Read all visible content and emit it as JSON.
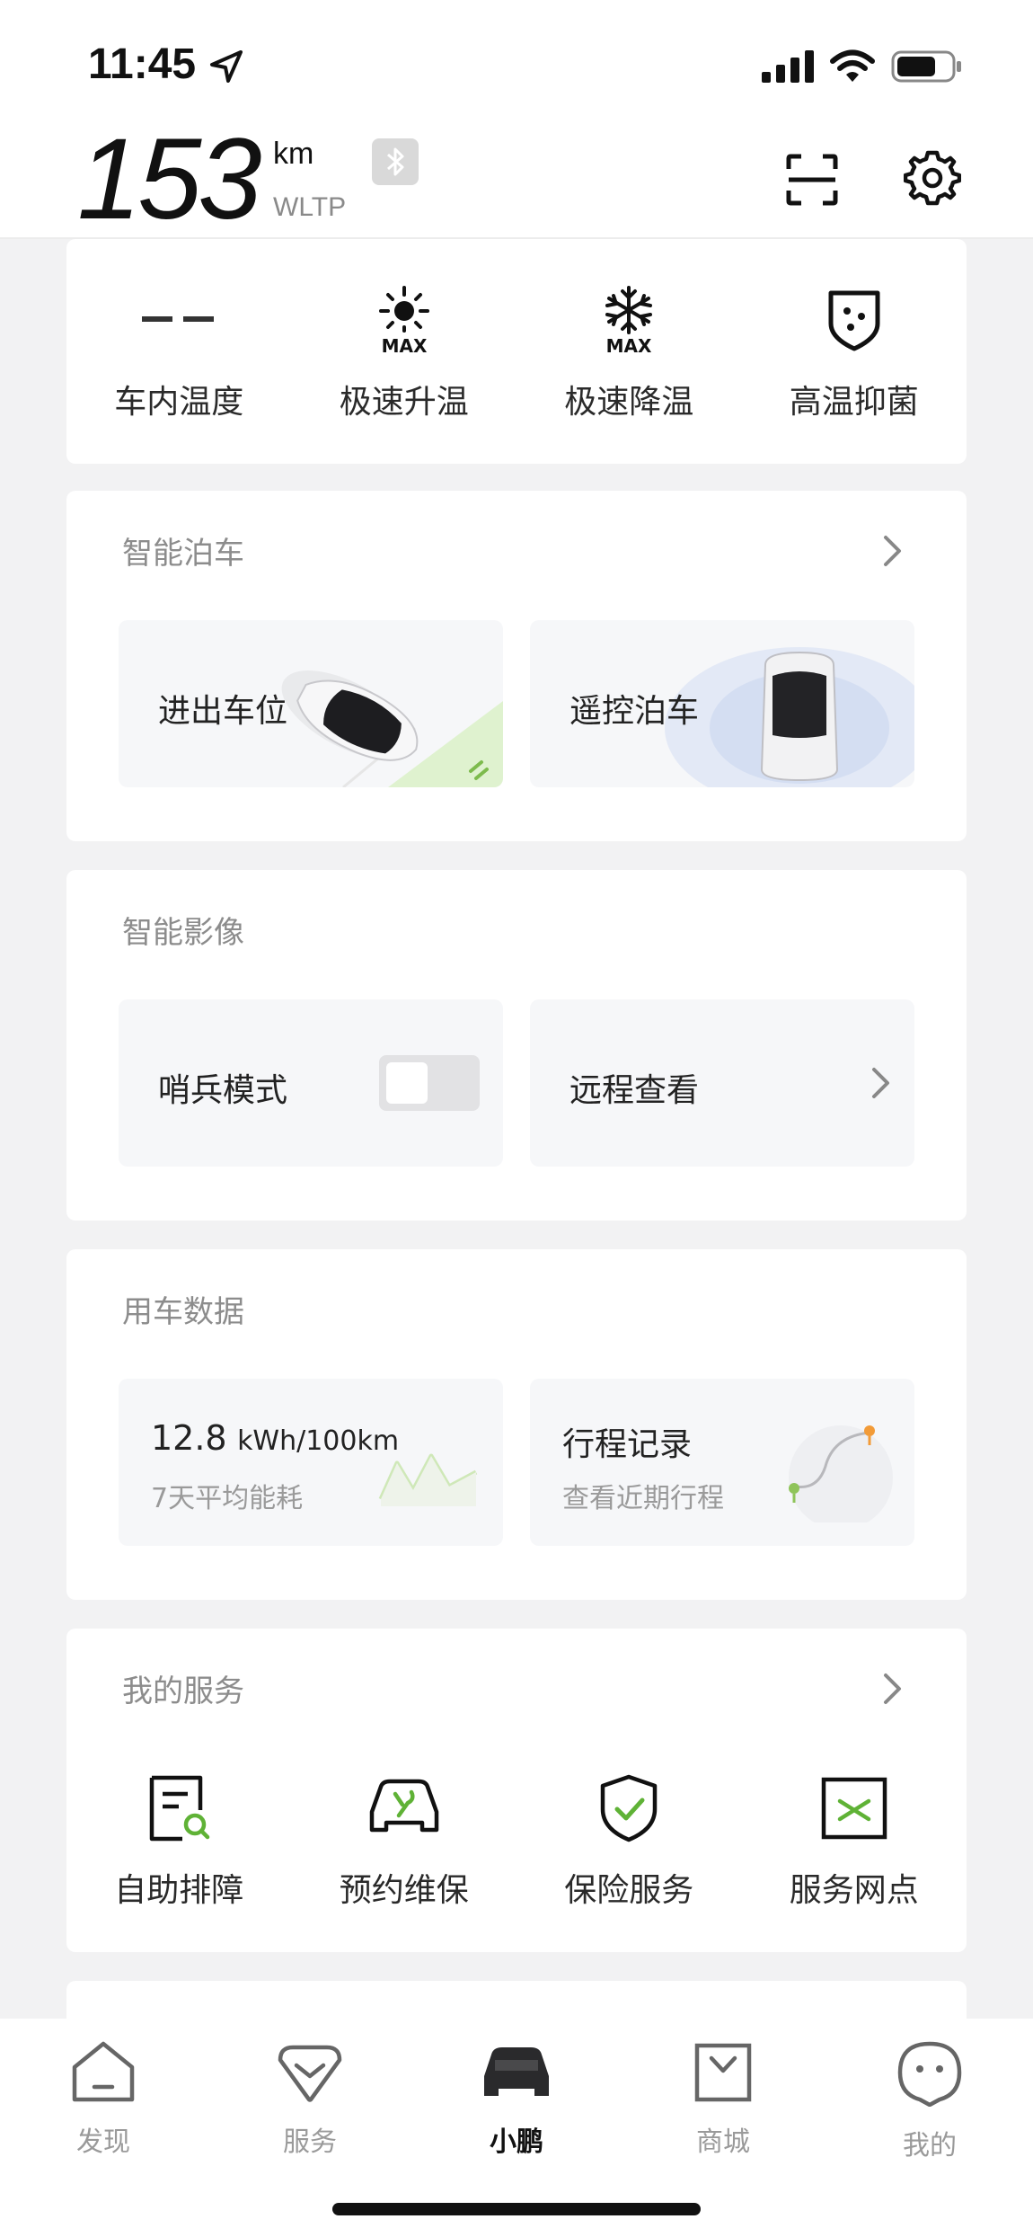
{
  "status": {
    "time": "11:45"
  },
  "header": {
    "range_value": "153",
    "range_unit": "km",
    "standard": "WLTP"
  },
  "climate": {
    "items": [
      {
        "label": "车内温度",
        "icon": "temperature-dash-icon"
      },
      {
        "label": "极速升温",
        "icon": "sun-max-icon"
      },
      {
        "label": "极速降温",
        "icon": "snowflake-max-icon"
      },
      {
        "label": "高温抑菌",
        "icon": "shield-dots-icon"
      }
    ]
  },
  "parking": {
    "title": "智能泊车",
    "tiles": [
      "进出车位",
      "遥控泊车"
    ]
  },
  "imaging": {
    "title": "智能影像",
    "sentry_label": "哨兵模式",
    "sentry_on": false,
    "remote_label": "远程查看"
  },
  "usage": {
    "title": "用车数据",
    "consumption_value": "12.8",
    "consumption_unit": "kWh/100km",
    "consumption_sub": "7天平均能耗",
    "trip_label": "行程记录",
    "trip_sub": "查看近期行程"
  },
  "services": {
    "title": "我的服务",
    "items": [
      {
        "label": "自助排障",
        "icon": "self-diagnosis-icon"
      },
      {
        "label": "预约维保",
        "icon": "car-wrench-icon"
      },
      {
        "label": "保险服务",
        "icon": "shield-check-icon"
      },
      {
        "label": "服务网点",
        "icon": "service-point-icon"
      }
    ]
  },
  "tabbar": {
    "tabs": [
      {
        "label": "发现",
        "icon": "home-icon"
      },
      {
        "label": "服务",
        "icon": "service-icon"
      },
      {
        "label": "小鹏",
        "icon": "car-icon",
        "active": true
      },
      {
        "label": "商城",
        "icon": "shop-bag-icon"
      },
      {
        "label": "我的",
        "icon": "profile-face-icon"
      }
    ]
  },
  "colors": {
    "accent_green": "#5fb236",
    "orange": "#f29b38",
    "text_muted": "#8c8c8c"
  }
}
